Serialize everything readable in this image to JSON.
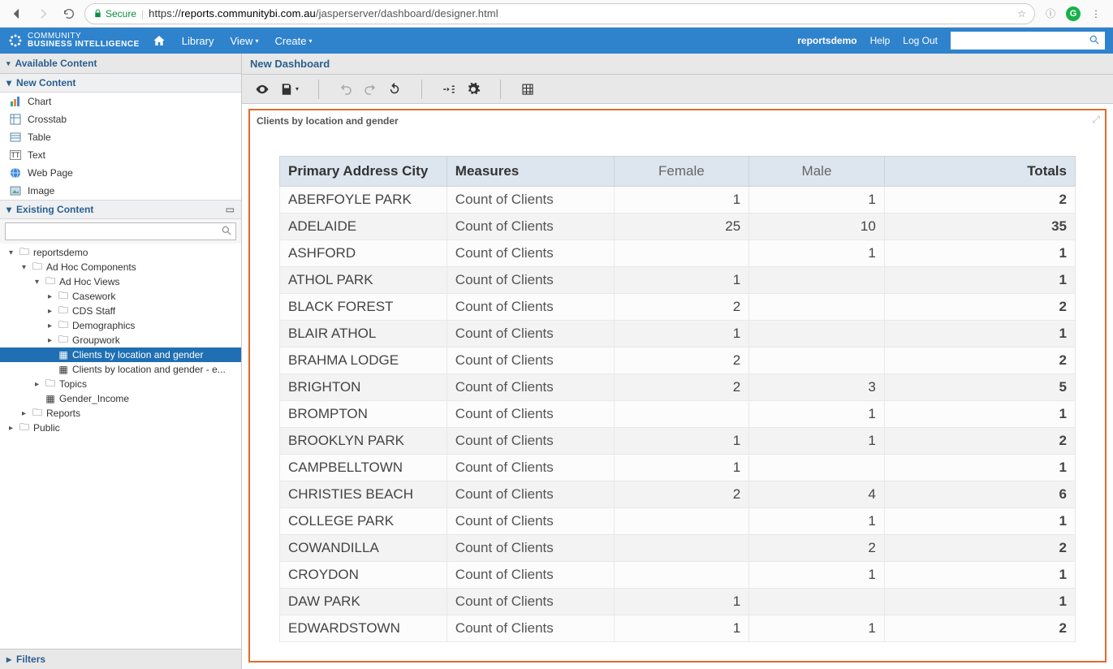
{
  "browser": {
    "secure_label": "Secure",
    "url_prefix": "https://",
    "url_host": "reports.communitybi.com.au",
    "url_path": "/jasperserver/dashboard/designer.html"
  },
  "brand": {
    "line1": "COMMUNITY",
    "line2": "BUSINESS INTELLIGENCE"
  },
  "nav": {
    "library": "Library",
    "view": "View",
    "create": "Create"
  },
  "user_nav": {
    "user": "reportsdemo",
    "help": "Help",
    "logout": "Log Out"
  },
  "sidebar": {
    "available_content": "Available Content",
    "new_content": "New Content",
    "new_items": {
      "chart": "Chart",
      "crosstab": "Crosstab",
      "table": "Table",
      "text": "Text",
      "webpage": "Web Page",
      "image": "Image"
    },
    "existing_content": "Existing Content",
    "tree": {
      "root": "reportsdemo",
      "adhoc_components": "Ad Hoc Components",
      "adhoc_views": "Ad Hoc Views",
      "casework": "Casework",
      "cds_staff": "CDS Staff",
      "demographics": "Demographics",
      "groupwork": "Groupwork",
      "clients_loc_gender": "Clients by location and gender",
      "clients_loc_gender_e": "Clients by location and gender - e...",
      "topics": "Topics",
      "gender_income": "Gender_Income",
      "reports": "Reports",
      "public": "Public"
    },
    "filters": "Filters"
  },
  "canvas": {
    "title": "New Dashboard",
    "widget_title": "Clients by location and gender"
  },
  "report": {
    "headers": {
      "city": "Primary Address City",
      "measures": "Measures",
      "female": "Female",
      "male": "Male",
      "totals": "Totals"
    },
    "measure_label": "Count of Clients",
    "rows": [
      {
        "city": "ABERFOYLE PARK",
        "female": "1",
        "male": "1",
        "total": "2"
      },
      {
        "city": "ADELAIDE",
        "female": "25",
        "male": "10",
        "total": "35"
      },
      {
        "city": "ASHFORD",
        "female": "",
        "male": "1",
        "total": "1"
      },
      {
        "city": "ATHOL PARK",
        "female": "1",
        "male": "",
        "total": "1"
      },
      {
        "city": "BLACK FOREST",
        "female": "2",
        "male": "",
        "total": "2"
      },
      {
        "city": "BLAIR ATHOL",
        "female": "1",
        "male": "",
        "total": "1"
      },
      {
        "city": "BRAHMA LODGE",
        "female": "2",
        "male": "",
        "total": "2"
      },
      {
        "city": "BRIGHTON",
        "female": "2",
        "male": "3",
        "total": "5"
      },
      {
        "city": "BROMPTON",
        "female": "",
        "male": "1",
        "total": "1"
      },
      {
        "city": "BROOKLYN PARK",
        "female": "1",
        "male": "1",
        "total": "2"
      },
      {
        "city": "CAMPBELLTOWN",
        "female": "1",
        "male": "",
        "total": "1"
      },
      {
        "city": "CHRISTIES BEACH",
        "female": "2",
        "male": "4",
        "total": "6"
      },
      {
        "city": "COLLEGE PARK",
        "female": "",
        "male": "1",
        "total": "1"
      },
      {
        "city": "COWANDILLA",
        "female": "",
        "male": "2",
        "total": "2"
      },
      {
        "city": "CROYDON",
        "female": "",
        "male": "1",
        "total": "1"
      },
      {
        "city": "DAW PARK",
        "female": "1",
        "male": "",
        "total": "1"
      },
      {
        "city": "EDWARDSTOWN",
        "female": "1",
        "male": "1",
        "total": "2"
      }
    ]
  }
}
